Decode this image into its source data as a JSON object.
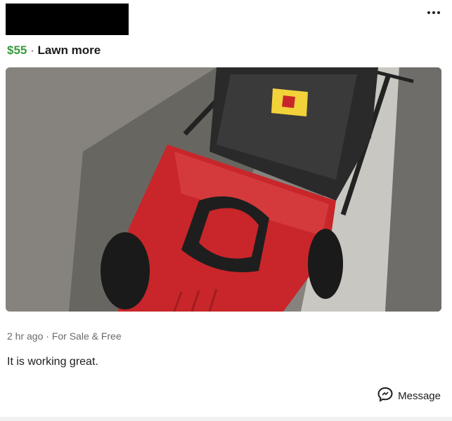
{
  "post": {
    "price": "$55",
    "separator": "·",
    "title": "Lawn more",
    "meta": "2 hr ago · For Sale & Free",
    "description": "It is working great."
  },
  "actions": {
    "message_label": "Message"
  },
  "colors": {
    "price_green": "#3a9a3e",
    "mower_red": "#c8262a",
    "mower_black": "#1e1e1e"
  },
  "icons": [
    "more-options-icon",
    "message-bubble-icon"
  ]
}
